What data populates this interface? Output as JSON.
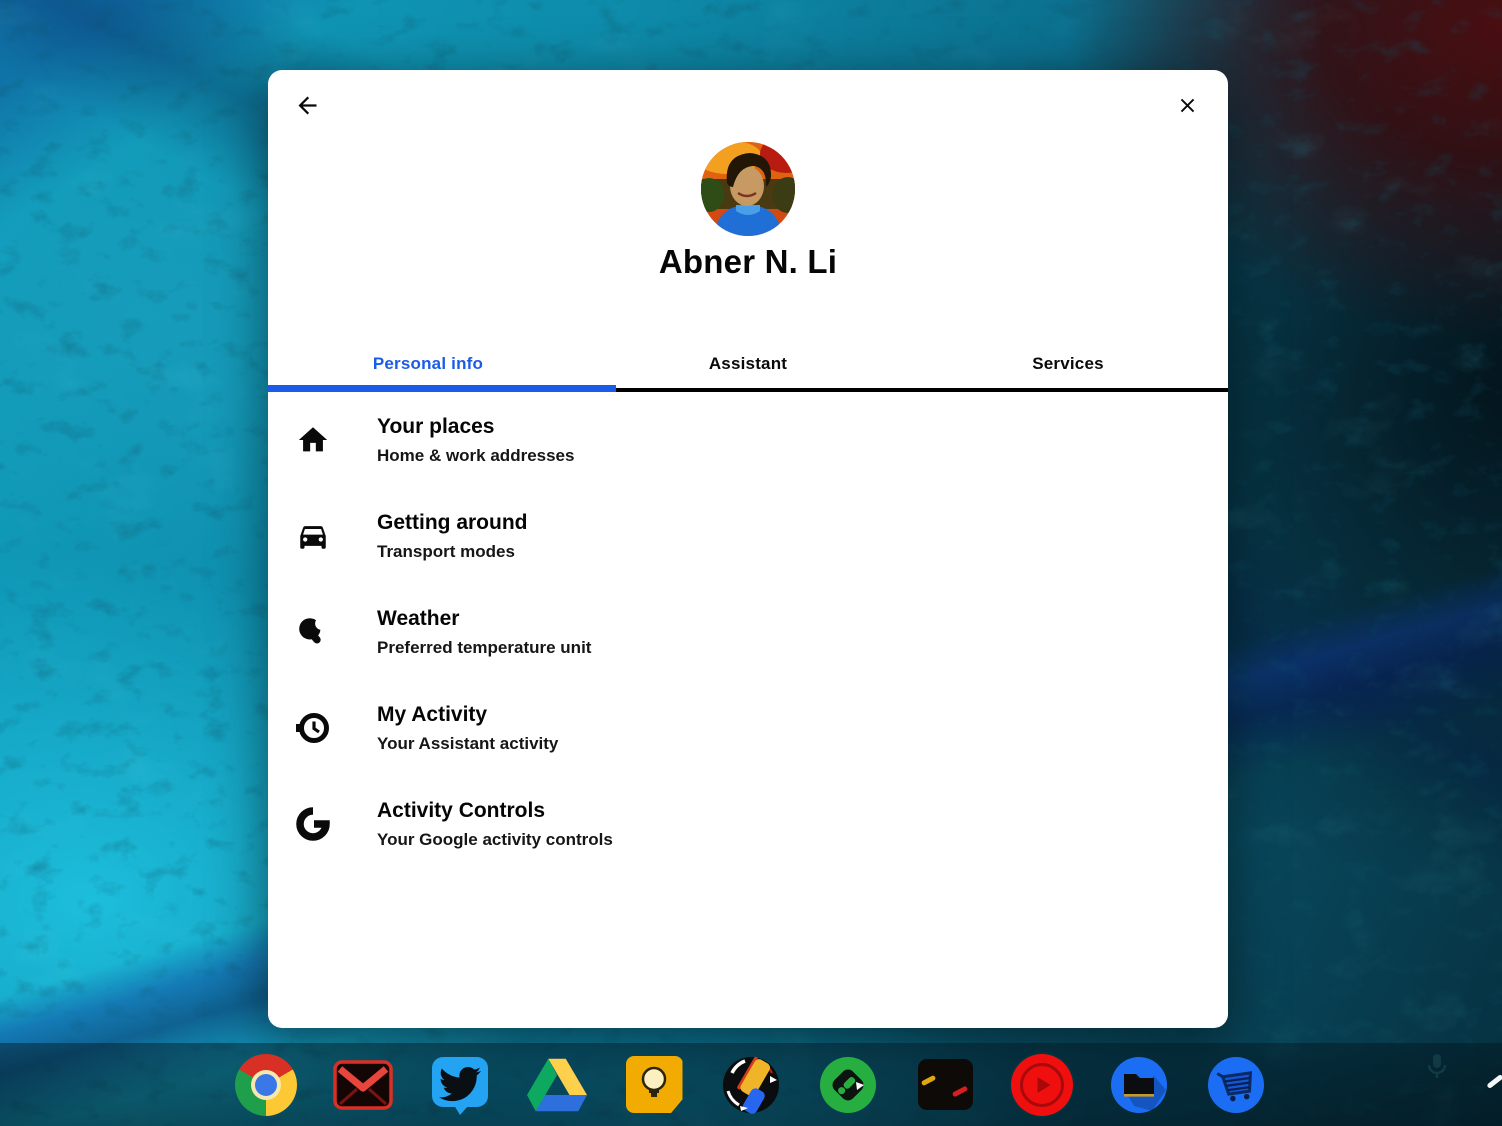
{
  "dialog": {
    "profile": {
      "name": "Abner N. Li"
    },
    "tabs": [
      {
        "label": "Personal info",
        "active": true
      },
      {
        "label": "Assistant",
        "active": false
      },
      {
        "label": "Services",
        "active": false
      }
    ],
    "menu_items": [
      {
        "icon": "home-icon",
        "title": "Your places",
        "subtitle": "Home & work addresses"
      },
      {
        "icon": "car-icon",
        "title": "Getting around",
        "subtitle": "Transport modes"
      },
      {
        "icon": "weather-icon",
        "title": "Weather",
        "subtitle": "Preferred temperature unit"
      },
      {
        "icon": "history-icon",
        "title": "My Activity",
        "subtitle": "Your Assistant activity"
      },
      {
        "icon": "google-g-icon",
        "title": "Activity Controls",
        "subtitle": "Your Google activity controls"
      }
    ],
    "icons": {
      "back": "arrow-back-icon",
      "close": "close-icon"
    },
    "accent_color": "#1a5ce8",
    "tab_divider_color": "#000000"
  },
  "shelf": {
    "apps": [
      "chrome",
      "gmail",
      "twitter",
      "google-drive",
      "google-keep",
      "adsense",
      "feedly",
      "black-app",
      "youtube-music",
      "files",
      "google-express"
    ],
    "tray_icons": [
      "microphone-icon"
    ]
  },
  "wallpaper": {
    "style": "blue rocky aerial texture",
    "colors": [
      "#10a0bf",
      "#0b7190",
      "#06303f",
      "#4c0c0e",
      "#1ec2e0"
    ]
  }
}
